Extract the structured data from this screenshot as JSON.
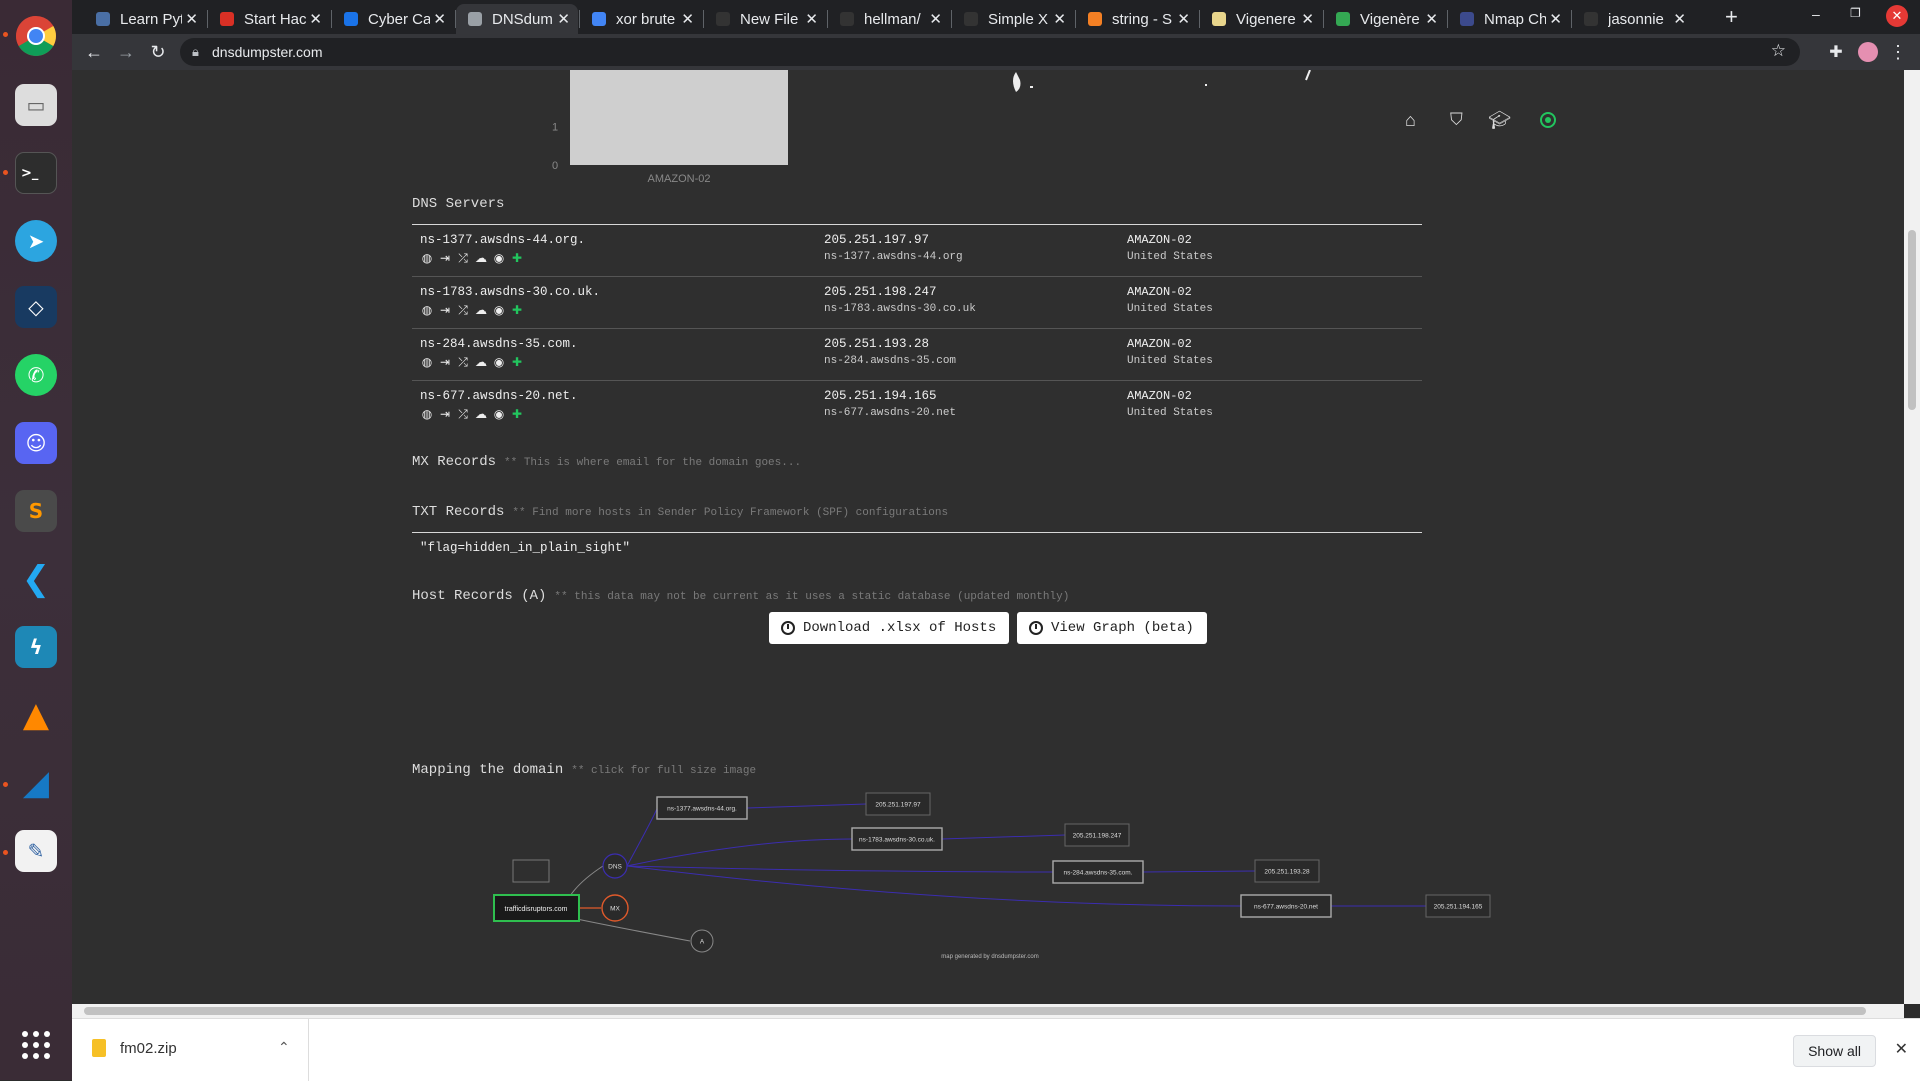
{
  "browser": {
    "tabs": [
      {
        "title": "Learn Pyt",
        "color": "#4a6fa5"
      },
      {
        "title": "Start Hac",
        "color": "#d93025"
      },
      {
        "title": "Cyber Ca",
        "color": "#1a73e8"
      },
      {
        "title": "DNSdum",
        "color": "#9aa0a6"
      },
      {
        "title": "xor brute",
        "color": "#4285f4"
      },
      {
        "title": "New File",
        "color": "#333333"
      },
      {
        "title": "hellman/",
        "color": "#333333"
      },
      {
        "title": "Simple X",
        "color": "#333333"
      },
      {
        "title": "string - S",
        "color": "#f48024"
      },
      {
        "title": "Vigenere",
        "color": "#e8d58c"
      },
      {
        "title": "Vigenère",
        "color": "#34a853"
      },
      {
        "title": "Nmap Ch",
        "color": "#3c4a8c"
      },
      {
        "title": "jasonnie",
        "color": "#333333"
      }
    ],
    "active_tab_index": 3,
    "address": "dnsdumpster.com"
  },
  "chart_data": {
    "type": "bar",
    "categories": [
      "AMAZON-02"
    ],
    "values": [
      4
    ],
    "visible_ticks": [
      "1",
      "0"
    ],
    "ylim": [
      0,
      4
    ]
  },
  "header_icons": [
    "home-icon",
    "shield-icon",
    "graduation-cap-icon",
    "target-icon"
  ],
  "dns_servers": {
    "title": "DNS Servers",
    "rows": [
      {
        "host": "ns-1377.awsdns-44.org.",
        "ip": "205.251.197.97",
        "reverse": "ns-1377.awsdns-44.org",
        "asn": "AMAZON-02",
        "country": "United States"
      },
      {
        "host": "ns-1783.awsdns-30.co.uk.",
        "ip": "205.251.198.247",
        "reverse": "ns-1783.awsdns-30.co.uk",
        "asn": "AMAZON-02",
        "country": "United States"
      },
      {
        "host": "ns-284.awsdns-35.com.",
        "ip": "205.251.193.28",
        "reverse": "ns-284.awsdns-35.com",
        "asn": "AMAZON-02",
        "country": "United States"
      },
      {
        "host": "ns-677.awsdns-20.net.",
        "ip": "205.251.194.165",
        "reverse": "ns-677.awsdns-20.net",
        "asn": "AMAZON-02",
        "country": "United States"
      }
    ]
  },
  "mx": {
    "title": "MX Records",
    "note": "** This is where email for the domain goes..."
  },
  "txt": {
    "title": "TXT Records",
    "note": "** Find more hosts in Sender Policy Framework (SPF) configurations",
    "value": "\"flag=hidden_in_plain_sight\""
  },
  "host": {
    "title": "Host Records (A)",
    "note": "** this data may not be current as it uses a static database (updated monthly)"
  },
  "buttons": {
    "download": "Download .xlsx of Hosts",
    "graph": "View Graph (beta)"
  },
  "mapping": {
    "title": "Mapping the domain",
    "note": "** click for full size image",
    "domain": "trafficdisruptors.com",
    "dns": "DNS",
    "mx": "MX",
    "a": "A",
    "ns_nodes": [
      "ns-1377.awsdns-44.org.",
      "ns-1783.awsdns-30.co.uk.",
      "ns-284.awsdns-35.com.",
      "ns-677.awsdns-20.net"
    ],
    "ip_nodes": [
      "205.251.197.97",
      "205.251.198.247",
      "205.251.193.28",
      "205.251.194.165"
    ],
    "credit": "map generated by dnsdumpster.com"
  },
  "downloads": {
    "file": "fm02.zip",
    "show_all": "Show all"
  }
}
